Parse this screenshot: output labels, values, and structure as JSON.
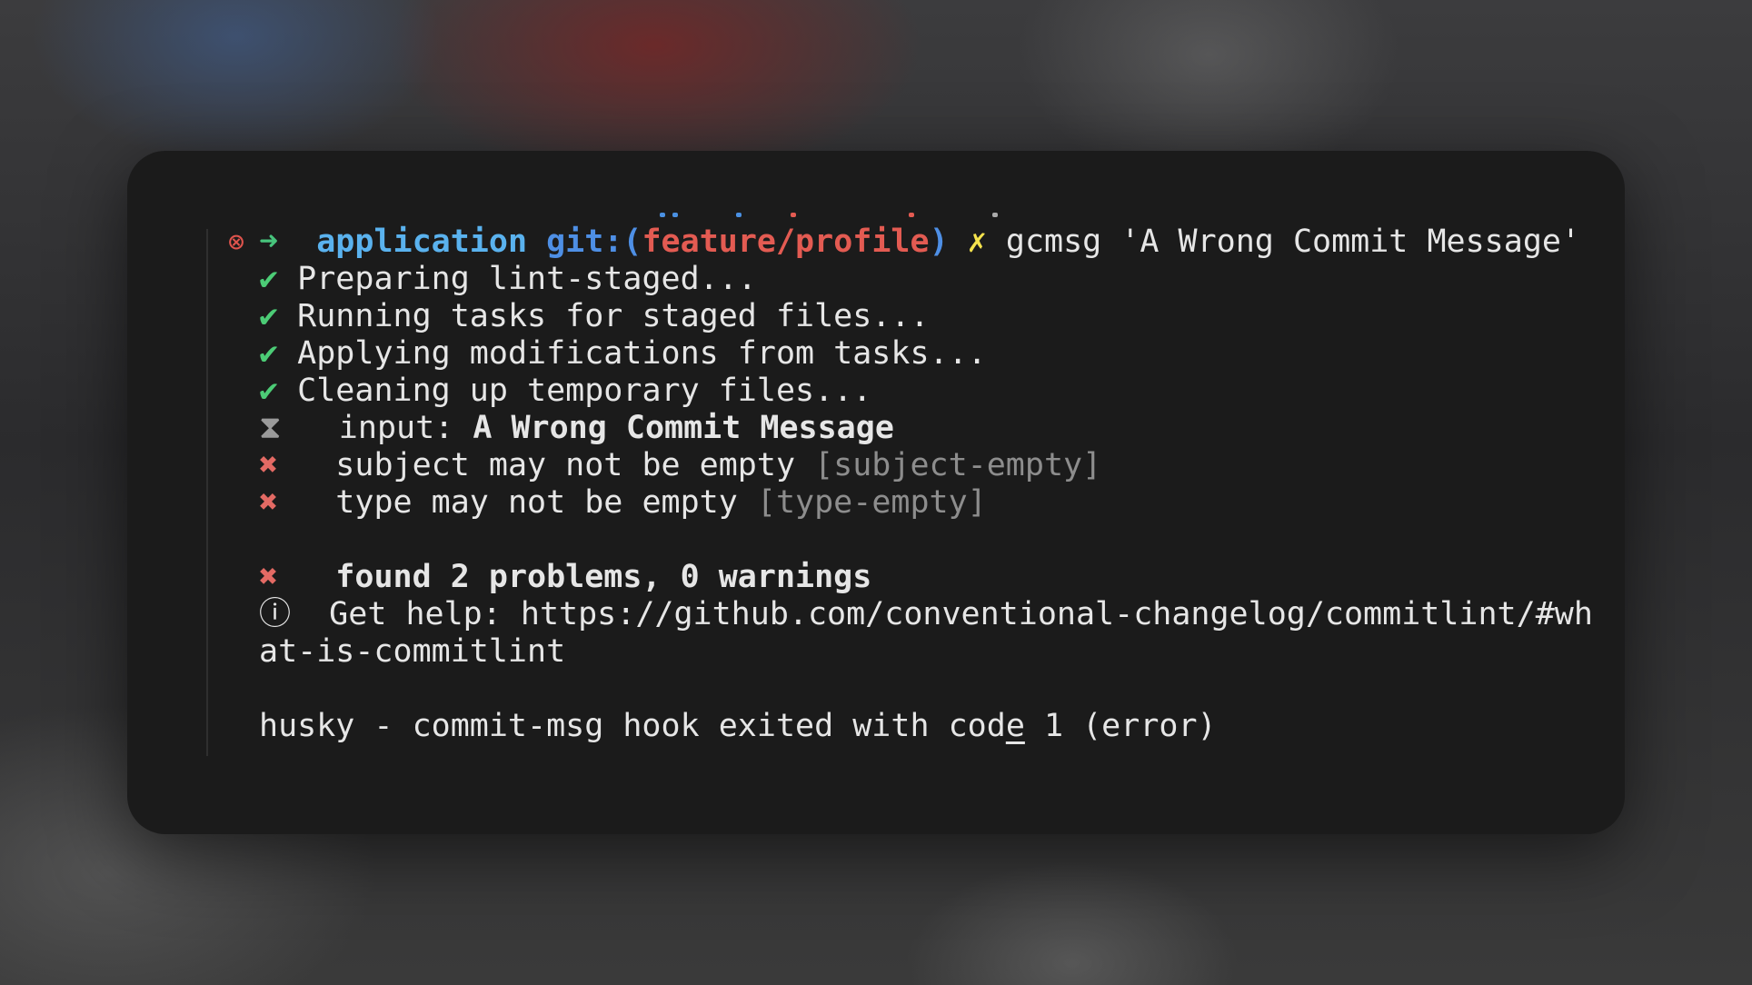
{
  "prompt": {
    "status_icon": "error-circle-icon",
    "arrow": "➜",
    "directory": "application",
    "git_prefix": "git:",
    "git_open": "(",
    "branch": "feature/profile",
    "git_close": ")",
    "dirty_mark": "✗",
    "command": "gcmsg 'A Wrong Commit Message'"
  },
  "lint_staged": [
    {
      "icon": "✔",
      "text": "Preparing lint-staged..."
    },
    {
      "icon": "✔",
      "text": "Running tasks for staged files..."
    },
    {
      "icon": "✔",
      "text": "Applying modifications from tasks..."
    },
    {
      "icon": "✔",
      "text": "Cleaning up temporary files..."
    }
  ],
  "commitlint": {
    "input_icon": "⧗",
    "input_label": "input: ",
    "input_value": "A Wrong Commit Message",
    "errors": [
      {
        "icon": "✖",
        "message": "subject may not be empty ",
        "rule": "[subject-empty]"
      },
      {
        "icon": "✖",
        "message": "type may not be empty ",
        "rule": "[type-empty]"
      }
    ],
    "summary_icon": "✖",
    "summary": "found 2 problems, 0 warnings",
    "help_icon": "ⓘ",
    "help_label": "Get help: ",
    "help_url_part1": "https://github.com/conventional-changelog/commitlint/#wh",
    "help_url_part2": "at-is-commitlint"
  },
  "husky": {
    "text_before": "husky - commit-msg hook exited with cod",
    "text_underlined": "e",
    "text_after": " 1 (error)"
  },
  "colors": {
    "terminal_bg": "#1b1b1b",
    "prompt_arrow": "#47c47c",
    "directory": "#5ab2ee",
    "git_label": "#4e8fe5",
    "branch": "#e35b52",
    "dirty": "#f5e34d",
    "check": "#4ccc76",
    "error": "#e36a64",
    "dim": "#8d8d8d"
  }
}
